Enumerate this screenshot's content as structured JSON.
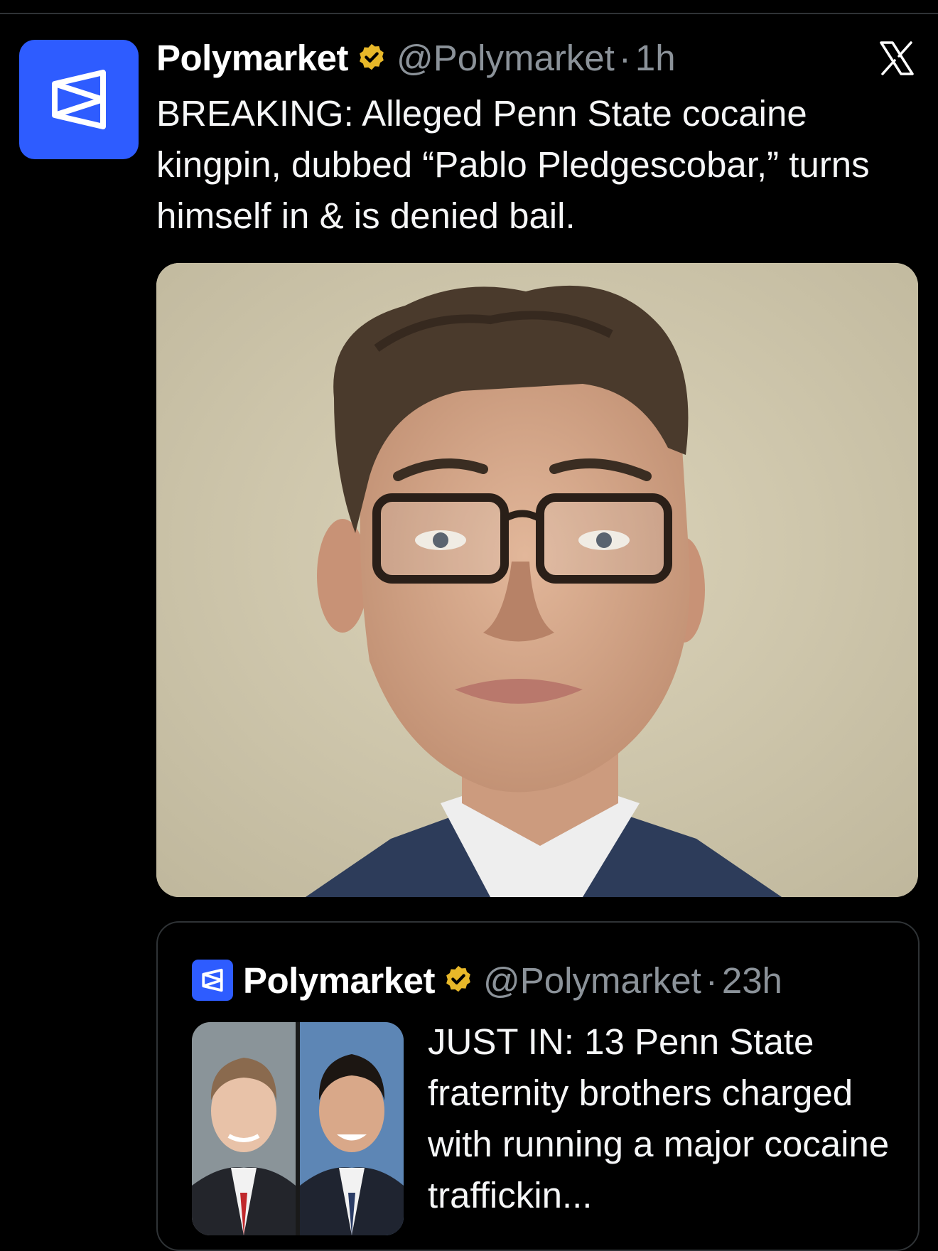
{
  "tweet": {
    "author_name": "Polymarket",
    "handle": "@Polymarket",
    "separator": "·",
    "time": "1h",
    "text": "BREAKING: Alleged Penn State cocaine kingpin, dubbed “Pablo Pledgescobar,” turns himself in & is denied bail.",
    "media_icon": "mugshot-photo",
    "verified_icon": "verified-badge-icon"
  },
  "quoted_tweet": {
    "author_name": "Polymarket",
    "handle": "@Polymarket",
    "separator": "·",
    "time": "23h",
    "text": "JUST IN: 13 Penn State fraternity brothers charged with running a major cocaine traffickin..."
  },
  "colors": {
    "background": "#000000",
    "brand_blue": "#2e5cff",
    "verified_gold": "#e8b829",
    "muted_text": "#8b9299",
    "border": "#2f3336"
  }
}
